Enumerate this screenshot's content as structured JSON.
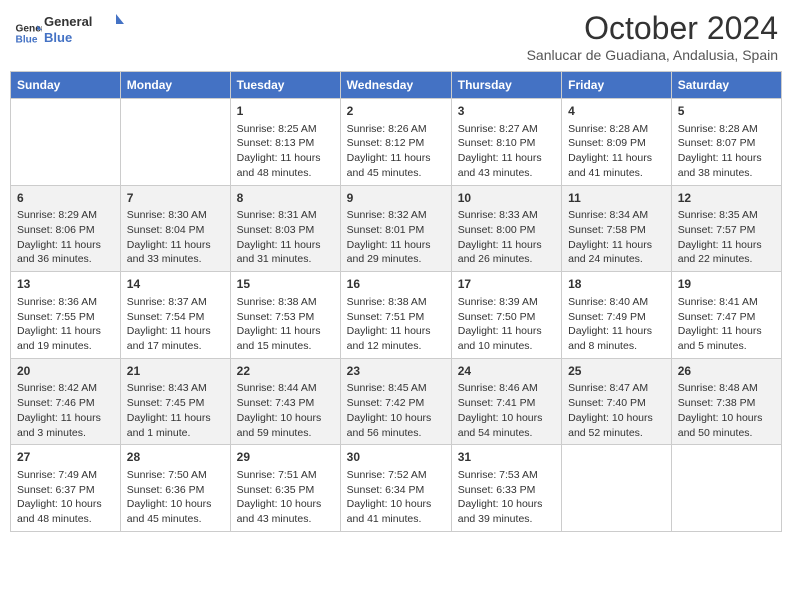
{
  "logo": {
    "line1": "General",
    "line2": "Blue"
  },
  "title": "October 2024",
  "subtitle": "Sanlucar de Guadiana, Andalusia, Spain",
  "days_of_week": [
    "Sunday",
    "Monday",
    "Tuesday",
    "Wednesday",
    "Thursday",
    "Friday",
    "Saturday"
  ],
  "weeks": [
    [
      {
        "day": "",
        "info": ""
      },
      {
        "day": "",
        "info": ""
      },
      {
        "day": "1",
        "info": "Sunrise: 8:25 AM\nSunset: 8:13 PM\nDaylight: 11 hours and 48 minutes."
      },
      {
        "day": "2",
        "info": "Sunrise: 8:26 AM\nSunset: 8:12 PM\nDaylight: 11 hours and 45 minutes."
      },
      {
        "day": "3",
        "info": "Sunrise: 8:27 AM\nSunset: 8:10 PM\nDaylight: 11 hours and 43 minutes."
      },
      {
        "day": "4",
        "info": "Sunrise: 8:28 AM\nSunset: 8:09 PM\nDaylight: 11 hours and 41 minutes."
      },
      {
        "day": "5",
        "info": "Sunrise: 8:28 AM\nSunset: 8:07 PM\nDaylight: 11 hours and 38 minutes."
      }
    ],
    [
      {
        "day": "6",
        "info": "Sunrise: 8:29 AM\nSunset: 8:06 PM\nDaylight: 11 hours and 36 minutes."
      },
      {
        "day": "7",
        "info": "Sunrise: 8:30 AM\nSunset: 8:04 PM\nDaylight: 11 hours and 33 minutes."
      },
      {
        "day": "8",
        "info": "Sunrise: 8:31 AM\nSunset: 8:03 PM\nDaylight: 11 hours and 31 minutes."
      },
      {
        "day": "9",
        "info": "Sunrise: 8:32 AM\nSunset: 8:01 PM\nDaylight: 11 hours and 29 minutes."
      },
      {
        "day": "10",
        "info": "Sunrise: 8:33 AM\nSunset: 8:00 PM\nDaylight: 11 hours and 26 minutes."
      },
      {
        "day": "11",
        "info": "Sunrise: 8:34 AM\nSunset: 7:58 PM\nDaylight: 11 hours and 24 minutes."
      },
      {
        "day": "12",
        "info": "Sunrise: 8:35 AM\nSunset: 7:57 PM\nDaylight: 11 hours and 22 minutes."
      }
    ],
    [
      {
        "day": "13",
        "info": "Sunrise: 8:36 AM\nSunset: 7:55 PM\nDaylight: 11 hours and 19 minutes."
      },
      {
        "day": "14",
        "info": "Sunrise: 8:37 AM\nSunset: 7:54 PM\nDaylight: 11 hours and 17 minutes."
      },
      {
        "day": "15",
        "info": "Sunrise: 8:38 AM\nSunset: 7:53 PM\nDaylight: 11 hours and 15 minutes."
      },
      {
        "day": "16",
        "info": "Sunrise: 8:38 AM\nSunset: 7:51 PM\nDaylight: 11 hours and 12 minutes."
      },
      {
        "day": "17",
        "info": "Sunrise: 8:39 AM\nSunset: 7:50 PM\nDaylight: 11 hours and 10 minutes."
      },
      {
        "day": "18",
        "info": "Sunrise: 8:40 AM\nSunset: 7:49 PM\nDaylight: 11 hours and 8 minutes."
      },
      {
        "day": "19",
        "info": "Sunrise: 8:41 AM\nSunset: 7:47 PM\nDaylight: 11 hours and 5 minutes."
      }
    ],
    [
      {
        "day": "20",
        "info": "Sunrise: 8:42 AM\nSunset: 7:46 PM\nDaylight: 11 hours and 3 minutes."
      },
      {
        "day": "21",
        "info": "Sunrise: 8:43 AM\nSunset: 7:45 PM\nDaylight: 11 hours and 1 minute."
      },
      {
        "day": "22",
        "info": "Sunrise: 8:44 AM\nSunset: 7:43 PM\nDaylight: 10 hours and 59 minutes."
      },
      {
        "day": "23",
        "info": "Sunrise: 8:45 AM\nSunset: 7:42 PM\nDaylight: 10 hours and 56 minutes."
      },
      {
        "day": "24",
        "info": "Sunrise: 8:46 AM\nSunset: 7:41 PM\nDaylight: 10 hours and 54 minutes."
      },
      {
        "day": "25",
        "info": "Sunrise: 8:47 AM\nSunset: 7:40 PM\nDaylight: 10 hours and 52 minutes."
      },
      {
        "day": "26",
        "info": "Sunrise: 8:48 AM\nSunset: 7:38 PM\nDaylight: 10 hours and 50 minutes."
      }
    ],
    [
      {
        "day": "27",
        "info": "Sunrise: 7:49 AM\nSunset: 6:37 PM\nDaylight: 10 hours and 48 minutes."
      },
      {
        "day": "28",
        "info": "Sunrise: 7:50 AM\nSunset: 6:36 PM\nDaylight: 10 hours and 45 minutes."
      },
      {
        "day": "29",
        "info": "Sunrise: 7:51 AM\nSunset: 6:35 PM\nDaylight: 10 hours and 43 minutes."
      },
      {
        "day": "30",
        "info": "Sunrise: 7:52 AM\nSunset: 6:34 PM\nDaylight: 10 hours and 41 minutes."
      },
      {
        "day": "31",
        "info": "Sunrise: 7:53 AM\nSunset: 6:33 PM\nDaylight: 10 hours and 39 minutes."
      },
      {
        "day": "",
        "info": ""
      },
      {
        "day": "",
        "info": ""
      }
    ]
  ]
}
